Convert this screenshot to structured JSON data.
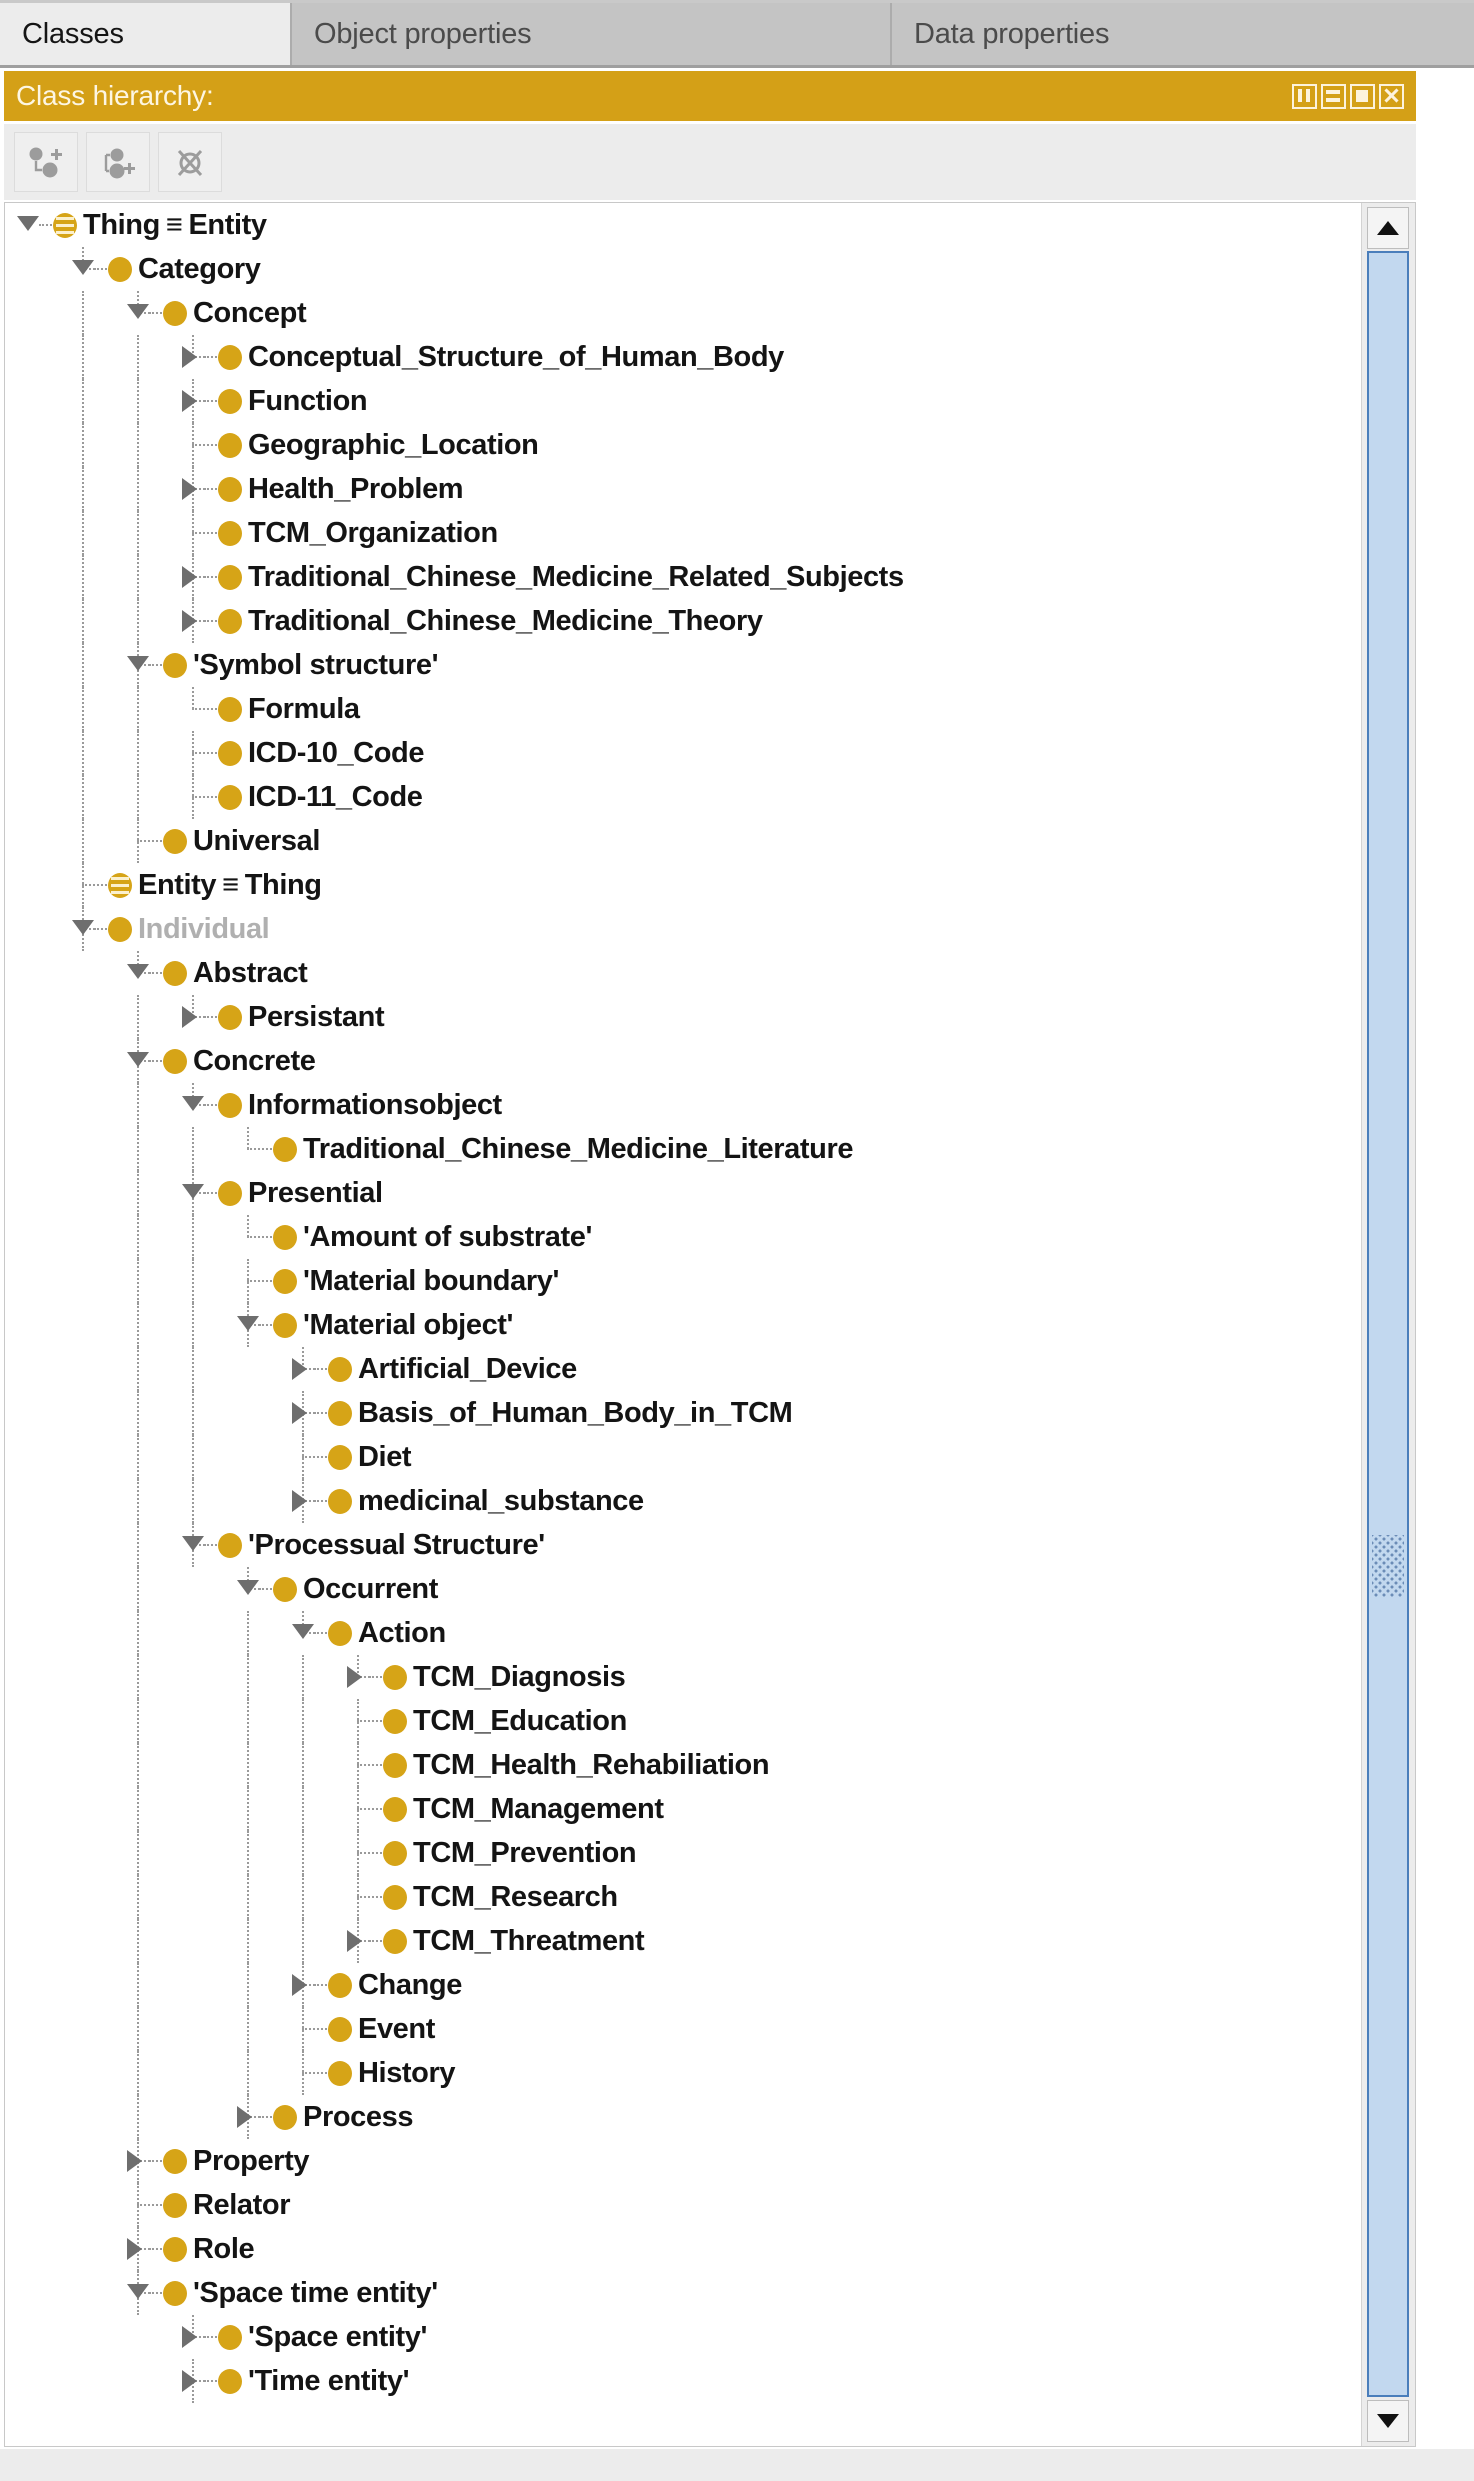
{
  "tabs": [
    {
      "label": "Classes",
      "active": true
    },
    {
      "label": "Object properties",
      "active": false
    },
    {
      "label": "Data properties",
      "active": false
    }
  ],
  "panel": {
    "title": "Class hierarchy:",
    "buttons": [
      {
        "name": "split-vertical-icon",
        "label": "Split vertically"
      },
      {
        "name": "split-horizontal-icon",
        "label": "Split horizontally"
      },
      {
        "name": "maximize-icon",
        "label": "Maximize panel"
      },
      {
        "name": "close-icon",
        "label": "Close panel"
      }
    ]
  },
  "toolbar": {
    "buttons": [
      {
        "name": "add-subclass-button",
        "label": "Add subclass"
      },
      {
        "name": "add-sibling-class-button",
        "label": "Add sibling class"
      },
      {
        "name": "delete-class-button",
        "label": "Delete class"
      }
    ]
  },
  "tree": {
    "rows": [
      {
        "label": "Thing",
        "equiv": "Entity",
        "depth": 0,
        "twisty": "open",
        "icon": "equivalent-class-icon",
        "muted": false
      },
      {
        "label": "Category",
        "depth": 1,
        "twisty": "open",
        "icon": "class-icon",
        "muted": false
      },
      {
        "label": "Concept",
        "depth": 2,
        "twisty": "open",
        "icon": "class-icon",
        "muted": false
      },
      {
        "label": "Conceptual_Structure_of_Human_Body",
        "depth": 3,
        "twisty": "closed",
        "icon": "class-icon",
        "muted": false
      },
      {
        "label": "Function",
        "depth": 3,
        "twisty": "closed",
        "icon": "class-icon",
        "muted": false
      },
      {
        "label": "Geographic_Location",
        "depth": 3,
        "twisty": "none",
        "icon": "class-icon",
        "muted": false
      },
      {
        "label": "Health_Problem",
        "depth": 3,
        "twisty": "closed",
        "icon": "class-icon",
        "muted": false
      },
      {
        "label": "TCM_Organization",
        "depth": 3,
        "twisty": "none",
        "icon": "class-icon",
        "muted": false
      },
      {
        "label": "Traditional_Chinese_Medicine_Related_Subjects",
        "depth": 3,
        "twisty": "closed",
        "icon": "class-icon",
        "muted": false
      },
      {
        "label": "Traditional_Chinese_Medicine_Theory",
        "depth": 3,
        "twisty": "closed",
        "icon": "class-icon",
        "muted": false
      },
      {
        "label": "'Symbol structure'",
        "depth": 2,
        "twisty": "open",
        "icon": "class-icon",
        "muted": false
      },
      {
        "label": "Formula",
        "depth": 3,
        "twisty": "none",
        "icon": "class-icon",
        "muted": false
      },
      {
        "label": "ICD-10_Code",
        "depth": 3,
        "twisty": "none",
        "icon": "class-icon",
        "muted": false
      },
      {
        "label": "ICD-11_Code",
        "depth": 3,
        "twisty": "none",
        "icon": "class-icon",
        "muted": false
      },
      {
        "label": "Universal",
        "depth": 2,
        "twisty": "none",
        "icon": "class-icon",
        "muted": false
      },
      {
        "label": "Entity",
        "equiv": "Thing",
        "depth": 1,
        "twisty": "none",
        "icon": "equivalent-class-icon",
        "muted": false
      },
      {
        "label": "Individual",
        "depth": 1,
        "twisty": "open",
        "icon": "class-icon",
        "muted": true
      },
      {
        "label": "Abstract",
        "depth": 2,
        "twisty": "open",
        "icon": "class-icon",
        "muted": false
      },
      {
        "label": "Persistant",
        "depth": 3,
        "twisty": "closed",
        "icon": "class-icon",
        "muted": false
      },
      {
        "label": "Concrete",
        "depth": 2,
        "twisty": "open",
        "icon": "class-icon",
        "muted": false
      },
      {
        "label": "Informationsobject",
        "depth": 3,
        "twisty": "open",
        "icon": "class-icon",
        "muted": false
      },
      {
        "label": "Traditional_Chinese_Medicine_Literature",
        "depth": 4,
        "twisty": "none",
        "icon": "class-icon",
        "muted": false
      },
      {
        "label": "Presential",
        "depth": 3,
        "twisty": "open",
        "icon": "class-icon",
        "muted": false
      },
      {
        "label": "'Amount of substrate'",
        "depth": 4,
        "twisty": "none",
        "icon": "class-icon",
        "muted": false
      },
      {
        "label": "'Material boundary'",
        "depth": 4,
        "twisty": "none",
        "icon": "class-icon",
        "muted": false
      },
      {
        "label": "'Material object'",
        "depth": 4,
        "twisty": "open",
        "icon": "class-icon",
        "muted": false
      },
      {
        "label": "Artificial_Device",
        "depth": 5,
        "twisty": "closed",
        "icon": "class-icon",
        "muted": false
      },
      {
        "label": "Basis_of_Human_Body_in_TCM",
        "depth": 5,
        "twisty": "closed",
        "icon": "class-icon",
        "muted": false
      },
      {
        "label": "Diet",
        "depth": 5,
        "twisty": "none",
        "icon": "class-icon",
        "muted": false
      },
      {
        "label": "medicinal_substance",
        "depth": 5,
        "twisty": "closed",
        "icon": "class-icon",
        "muted": false
      },
      {
        "label": "'Processual Structure'",
        "depth": 3,
        "twisty": "open",
        "icon": "class-icon",
        "muted": false
      },
      {
        "label": "Occurrent",
        "depth": 4,
        "twisty": "open",
        "icon": "class-icon",
        "muted": false
      },
      {
        "label": "Action",
        "depth": 5,
        "twisty": "open",
        "icon": "class-icon",
        "muted": false
      },
      {
        "label": "TCM_Diagnosis",
        "depth": 6,
        "twisty": "closed",
        "icon": "class-icon",
        "muted": false
      },
      {
        "label": "TCM_Education",
        "depth": 6,
        "twisty": "none",
        "icon": "class-icon",
        "muted": false
      },
      {
        "label": "TCM_Health_Rehabiliation",
        "depth": 6,
        "twisty": "none",
        "icon": "class-icon",
        "muted": false
      },
      {
        "label": "TCM_Management",
        "depth": 6,
        "twisty": "none",
        "icon": "class-icon",
        "muted": false
      },
      {
        "label": "TCM_Prevention",
        "depth": 6,
        "twisty": "none",
        "icon": "class-icon",
        "muted": false
      },
      {
        "label": "TCM_Research",
        "depth": 6,
        "twisty": "none",
        "icon": "class-icon",
        "muted": false
      },
      {
        "label": "TCM_Threatment",
        "depth": 6,
        "twisty": "closed",
        "icon": "class-icon",
        "muted": false
      },
      {
        "label": "Change",
        "depth": 5,
        "twisty": "closed",
        "icon": "class-icon",
        "muted": false
      },
      {
        "label": "Event",
        "depth": 5,
        "twisty": "none",
        "icon": "class-icon",
        "muted": false
      },
      {
        "label": "History",
        "depth": 5,
        "twisty": "none",
        "icon": "class-icon",
        "muted": false
      },
      {
        "label": "Process",
        "depth": 4,
        "twisty": "closed",
        "icon": "class-icon",
        "muted": false
      },
      {
        "label": "Property",
        "depth": 2,
        "twisty": "closed",
        "icon": "class-icon",
        "muted": false
      },
      {
        "label": "Relator",
        "depth": 2,
        "twisty": "none",
        "icon": "class-icon",
        "muted": false
      },
      {
        "label": "Role",
        "depth": 2,
        "twisty": "closed",
        "icon": "class-icon",
        "muted": false
      },
      {
        "label": "'Space time entity'",
        "depth": 2,
        "twisty": "open",
        "icon": "class-icon",
        "muted": false
      },
      {
        "label": "'Space entity'",
        "depth": 3,
        "twisty": "closed",
        "icon": "class-icon",
        "muted": false
      },
      {
        "label": "'Time entity'",
        "depth": 3,
        "twisty": "closed",
        "icon": "class-icon",
        "muted": false
      }
    ]
  },
  "scrollbar": {
    "up_arrow": "scroll-up-arrow-icon",
    "down_arrow": "scroll-down-arrow-icon"
  },
  "colors": {
    "accent_gold": "#d4a017",
    "class_icon": "#d6a417",
    "scroll_thumb": "#c2d8ef",
    "scroll_thumb_border": "#4a7ebb",
    "tab_active_bg": "#ececec",
    "tab_inactive_bg": "#c4c4c4"
  }
}
